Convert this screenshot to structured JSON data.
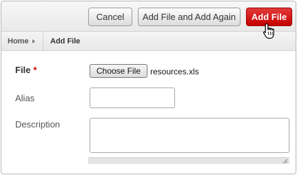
{
  "toolbar": {
    "cancel_label": "Cancel",
    "add_again_label": "Add File and Add Again",
    "add_file_label": "Add File"
  },
  "breadcrumb": {
    "home": "Home",
    "current": "Add File"
  },
  "form": {
    "file": {
      "label": "File",
      "required_marker": "*",
      "choose_button": "Choose File",
      "selected_file": "resources.xls"
    },
    "alias": {
      "label": "Alias",
      "value": ""
    },
    "description": {
      "label": "Description",
      "value": ""
    }
  },
  "colors": {
    "primary_button": "#d00000",
    "required": "#d00000"
  },
  "icons": {
    "cursor": "hand-pointer-icon",
    "breadcrumb_separator": "triangle-right-icon",
    "resize_grip": "resize-grip-icon"
  }
}
